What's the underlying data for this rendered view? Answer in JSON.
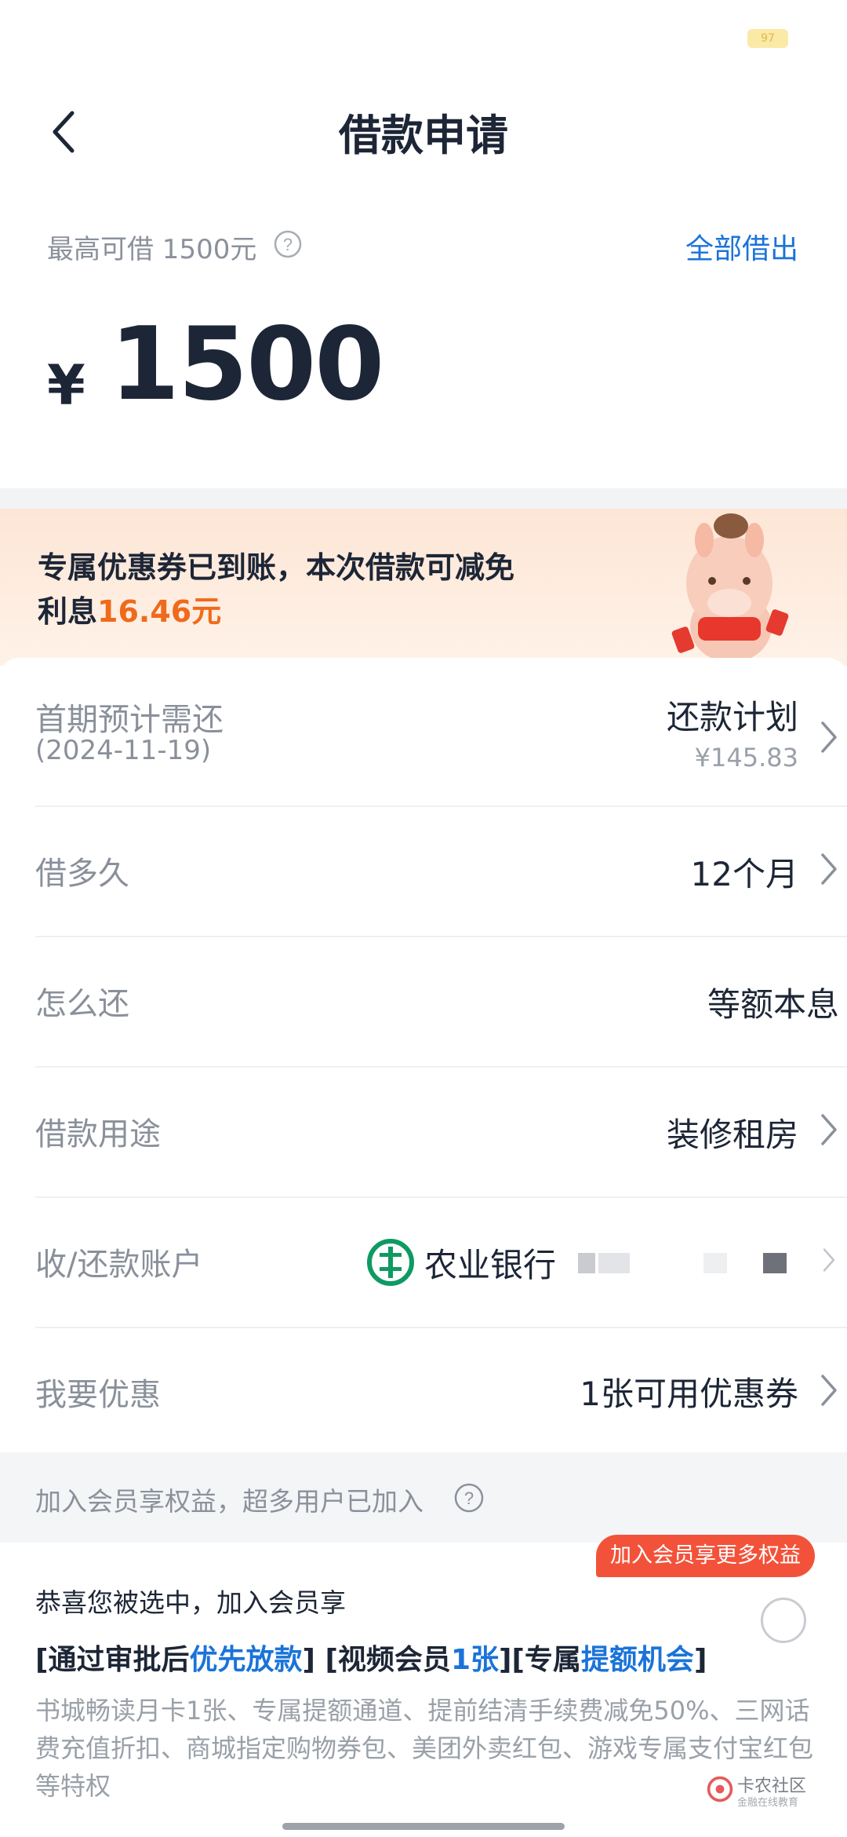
{
  "status": {
    "battery": "97"
  },
  "nav": {
    "title": "借款申请",
    "back_icon": "chevron-left-icon"
  },
  "limit": {
    "text": "最高可借 1500元",
    "borrow_all": "全部借出"
  },
  "amount": {
    "currency": "¥",
    "value": "1500"
  },
  "promo": {
    "line1": "专属优惠券已到账，本次借款可减免",
    "line2_prefix": "利息",
    "line2_amount": "16.46元",
    "mascot": "mascot-illustration"
  },
  "rows": {
    "first_payment": {
      "label": "首期预计需还",
      "date": "(2024-11-19)",
      "value": "还款计划",
      "sub": "¥145.83"
    },
    "term": {
      "label": "借多久",
      "value": "12个月"
    },
    "method": {
      "label": "怎么还",
      "value": "等额本息"
    },
    "purpose": {
      "label": "借款用途",
      "value": "装修租房"
    },
    "account": {
      "label": "收/还款账户",
      "value": "农业银行",
      "bank_icon": "abc-bank-icon"
    },
    "discount": {
      "label": "我要优惠",
      "value": "1张可用优惠券"
    }
  },
  "membership": {
    "header": "加入会员享权益，超多用户已加入",
    "badge": "加入会员享更多权益",
    "title": "恭喜您被选中，加入会员享",
    "b1_pre": "[通过审批后",
    "b1_hl": "优先放款",
    "b1_post": "] [视频会员",
    "b2_hl": "1张",
    "b2_post": "][专属",
    "b3_hl": "提额机会",
    "b3_post": "]",
    "desc": "书城畅读月卡1张、专属提额通道、提前结清手续费减免50%、三网话费充值折扣、商城指定购物券包、美团外卖红包、游戏专属支付宝红包等特权"
  },
  "watermark": {
    "text": "卡农社区",
    "sub": "金融在线教育"
  },
  "colors": {
    "accent_blue": "#1a73d9",
    "promo_orange": "#f06a1c",
    "badge_red": "#f3523a",
    "bank_green": "#0f9a63"
  }
}
